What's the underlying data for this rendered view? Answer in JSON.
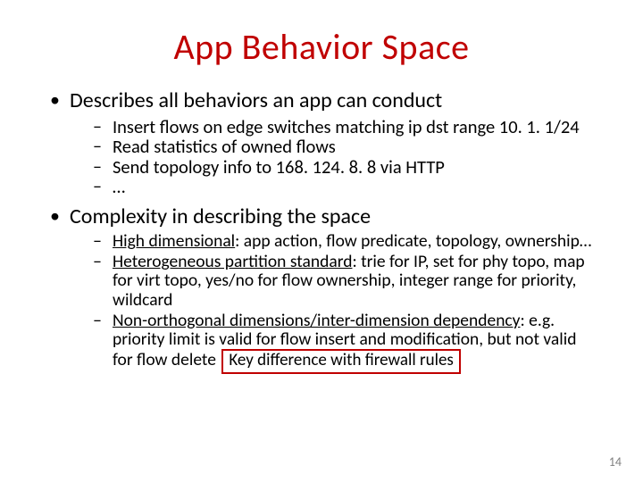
{
  "title": "App Behavior Space",
  "bullets": [
    {
      "text": "Describes all behaviors an app can conduct",
      "sub": [
        {
          "text": "Insert flows on edge switches matching ip dst range 10. 1. 1/24"
        },
        {
          "text": "Read statistics of owned flows"
        },
        {
          "text": "Send topology info to 168. 124. 8. 8 via HTTP"
        },
        {
          "text": "…"
        }
      ]
    },
    {
      "text": "Complexity in describing the space",
      "sub": [
        {
          "emph": "High dimensional",
          "rest": ": app action, flow predicate, topology, ownership…"
        },
        {
          "emph": "Heterogeneous partition standard",
          "rest": ": trie for IP, set for phy topo, map for virt topo, yes/no for flow ownership, integer range for priority, wildcard"
        },
        {
          "emph": "Non-orthogonal dimensions/inter-dimension dependency",
          "rest": ": e.g. priority limit is valid for flow insert and modification, but not valid for flow delete",
          "callout": "Key difference with firewall rules"
        }
      ]
    }
  ],
  "page_number": "14"
}
